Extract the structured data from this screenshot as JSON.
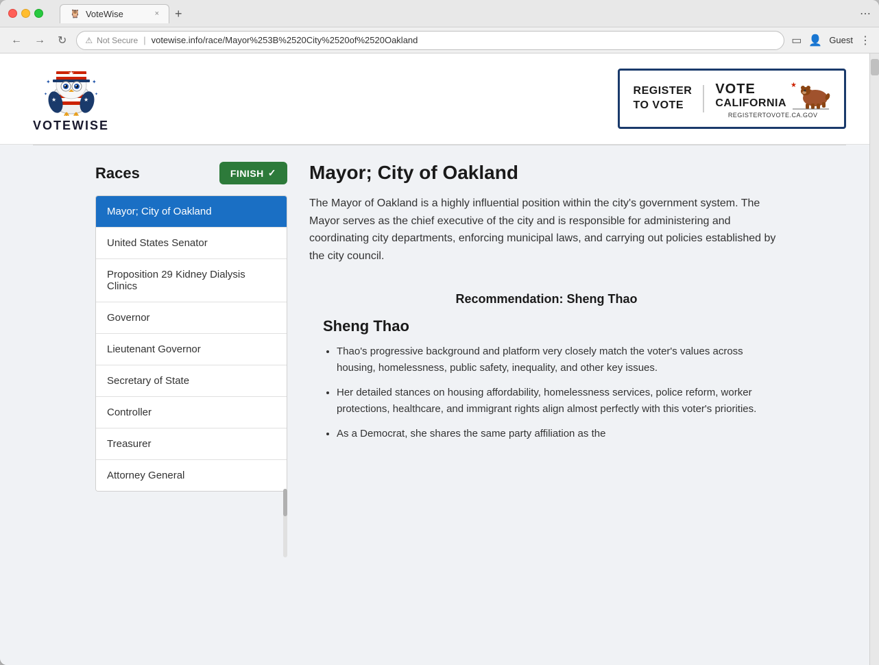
{
  "browser": {
    "title": "VoteWise",
    "url": "votewise.info/race/Mayor%253B%2520City%2520of%2520Oakland",
    "url_display": "votewise.info/race/Mayor%253B%2520City%2520of%2520Oakland",
    "security_label": "Not Secure",
    "guest_label": "Guest",
    "tab_close": "×",
    "tab_new": "+"
  },
  "header": {
    "logo_text": "VOTEWISE",
    "register_line1": "REGISTER",
    "register_line2": "TO VOTE",
    "divider": "|",
    "vote_ca_line1": "VOTE",
    "vote_ca_line2": "CALIFORNIA",
    "vote_ca_url": "REGISTERTOVOTE.CA.GOV"
  },
  "sidebar": {
    "title": "Races",
    "finish_btn": "FINISH",
    "finish_chevron": "✓",
    "races": [
      {
        "label": "Mayor; City of Oakland",
        "active": true
      },
      {
        "label": "United States Senator",
        "active": false
      },
      {
        "label": "Proposition 29 Kidney Dialysis Clinics",
        "active": false
      },
      {
        "label": "Governor",
        "active": false
      },
      {
        "label": "Lieutenant Governor",
        "active": false
      },
      {
        "label": "Secretary of State",
        "active": false
      },
      {
        "label": "Controller",
        "active": false
      },
      {
        "label": "Treasurer",
        "active": false
      },
      {
        "label": "Attorney General",
        "active": false
      }
    ]
  },
  "content": {
    "race_title": "Mayor; City of Oakland",
    "description": "The Mayor of Oakland is a highly influential position within the city's government system. The Mayor serves as the chief executive of the city and is responsible for administering and coordinating city departments, enforcing municipal laws, and carrying out policies established by the city council.",
    "recommendation_header": "Recommendation: Sheng Thao",
    "candidate_name": "Sheng Thao",
    "bullet_points": [
      "Thao's progressive background and platform very closely match the voter's values across housing, homelessness, public safety, inequality, and other key issues.",
      "Her detailed stances on housing affordability, homelessness services, police reform, worker protections, healthcare, and immigrant rights align almost perfectly with this voter's priorities.",
      "As a Democrat, she shares the same party affiliation as the"
    ]
  },
  "colors": {
    "active_bg": "#1a6fc4",
    "finish_btn_bg": "#2d7a3a",
    "accent_blue": "#1a3a6b"
  }
}
